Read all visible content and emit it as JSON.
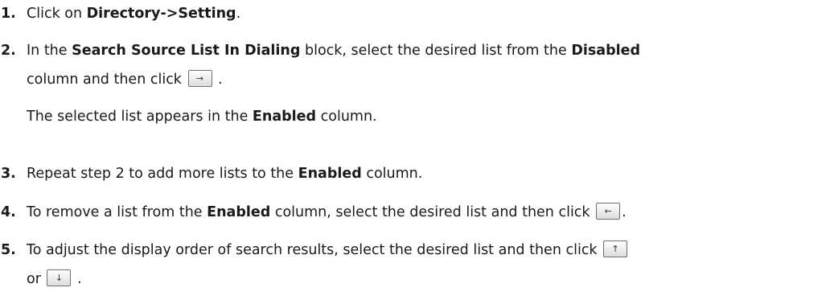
{
  "steps": [
    {
      "number": "1.",
      "click_on": "Click on ",
      "menu_path": "Directory->Setting",
      "end": "."
    },
    {
      "number": "2.",
      "in_the": "In the ",
      "block_name": "Search Source List In Dialing",
      "block_text": " block, select the desired list from the ",
      "disabled": "Disabled",
      "column_then_click": "column and then click",
      "end": ".",
      "result_prefix": "The selected list appears in the ",
      "enabled": "Enabled",
      "result_suffix": " column."
    },
    {
      "number": "3.",
      "text": "Repeat step 2 to add more lists to the ",
      "enabled": "Enabled",
      "suffix": " column."
    },
    {
      "number": "4.",
      "prefix": "To remove a list from the ",
      "enabled": "Enabled",
      "suffix": " column, select the desired list and then click",
      "end": "."
    },
    {
      "number": "5.",
      "text": "To adjust the display order of search results, select the desired list and then click",
      "or": "or",
      "end": "."
    }
  ],
  "buttons": {
    "right_arrow": "→",
    "left_arrow": "←",
    "up_arrow": "↑",
    "down_arrow": "↓"
  },
  "icons": {
    "right": "right-arrow-icon",
    "left": "left-arrow-icon",
    "up": "up-arrow-icon",
    "down": "down-arrow-icon"
  }
}
